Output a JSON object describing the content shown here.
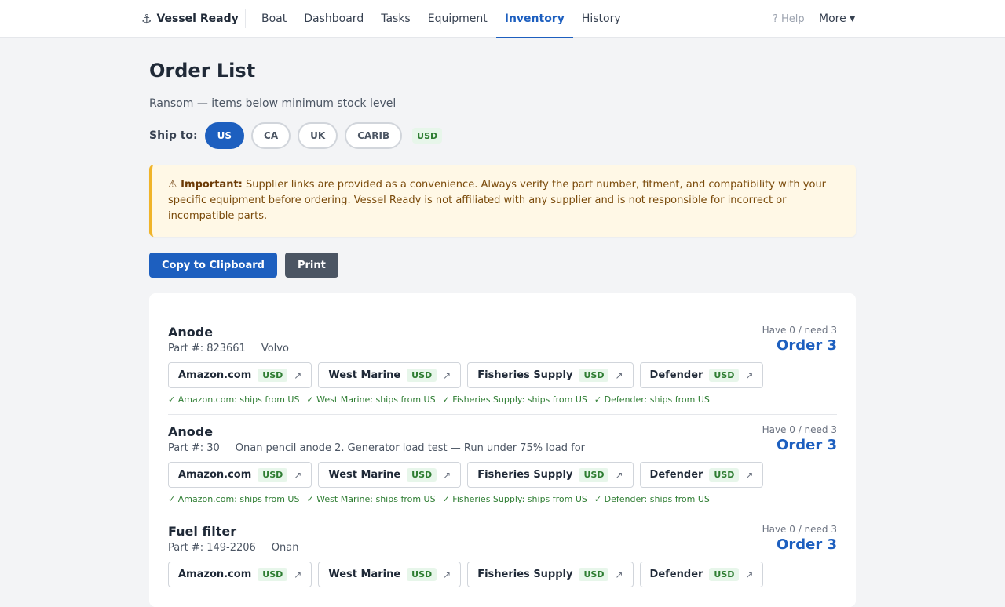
{
  "brand": {
    "icon": "anchor-icon",
    "name": "Vessel Ready"
  },
  "nav": [
    {
      "label": "Boat"
    },
    {
      "label": "Dashboard"
    },
    {
      "label": "Tasks"
    },
    {
      "label": "Equipment"
    },
    {
      "label": "Inventory",
      "active": true
    },
    {
      "label": "History"
    }
  ],
  "help_label": "? Help",
  "more_label": "More ▾",
  "page": {
    "title": "Order List",
    "subtitle": "Ransom — items below minimum stock level",
    "ship_to_label": "Ship to:",
    "regions": [
      "US",
      "CA",
      "UK",
      "CARIB"
    ],
    "active_region": "US",
    "currency": "USD"
  },
  "notice": {
    "icon": "warning-icon",
    "strong": "⚠ Important:",
    "text": " Supplier links are provided as a convenience. Always verify the part number, fitment, and compatibility with your specific equipment before ordering. Vessel Ready is not affiliated with any supplier and is not responsible for incorrect or incompatible parts."
  },
  "actions": {
    "copy": "Copy to Clipboard",
    "print": "Print"
  },
  "items": [
    {
      "name": "Anode",
      "part": "Part #: 823661",
      "desc": "Volvo",
      "have": "Have 0 / need 3",
      "order": "Order 3",
      "suppliers": [
        {
          "name": "Amazon.com",
          "cur": "USD"
        },
        {
          "name": "West Marine",
          "cur": "USD"
        },
        {
          "name": "Fisheries Supply",
          "cur": "USD"
        },
        {
          "name": "Defender",
          "cur": "USD"
        }
      ],
      "ships": [
        "✓ Amazon.com: ships from US",
        "✓ West Marine: ships from US",
        "✓ Fisheries Supply: ships from US",
        "✓ Defender: ships from US"
      ]
    },
    {
      "name": "Anode",
      "part": "Part #: 30",
      "desc": "Onan pencil anode 2. Generator load test — Run under 75% load for",
      "have": "Have 0 / need 3",
      "order": "Order 3",
      "suppliers": [
        {
          "name": "Amazon.com",
          "cur": "USD"
        },
        {
          "name": "West Marine",
          "cur": "USD"
        },
        {
          "name": "Fisheries Supply",
          "cur": "USD"
        },
        {
          "name": "Defender",
          "cur": "USD"
        }
      ],
      "ships": [
        "✓ Amazon.com: ships from US",
        "✓ West Marine: ships from US",
        "✓ Fisheries Supply: ships from US",
        "✓ Defender: ships from US"
      ]
    },
    {
      "name": "Fuel filter",
      "part": "Part #: 149-2206",
      "desc": "Onan",
      "have": "Have 0 / need 3",
      "order": "Order 3",
      "suppliers": [
        {
          "name": "Amazon.com",
          "cur": "USD"
        },
        {
          "name": "West Marine",
          "cur": "USD"
        },
        {
          "name": "Fisheries Supply",
          "cur": "USD"
        },
        {
          "name": "Defender",
          "cur": "USD"
        }
      ],
      "ships": []
    }
  ],
  "colors": {
    "accent": "#1d5fbf",
    "ok_green": "#2e7d32",
    "warning_border": "#f0b429"
  }
}
